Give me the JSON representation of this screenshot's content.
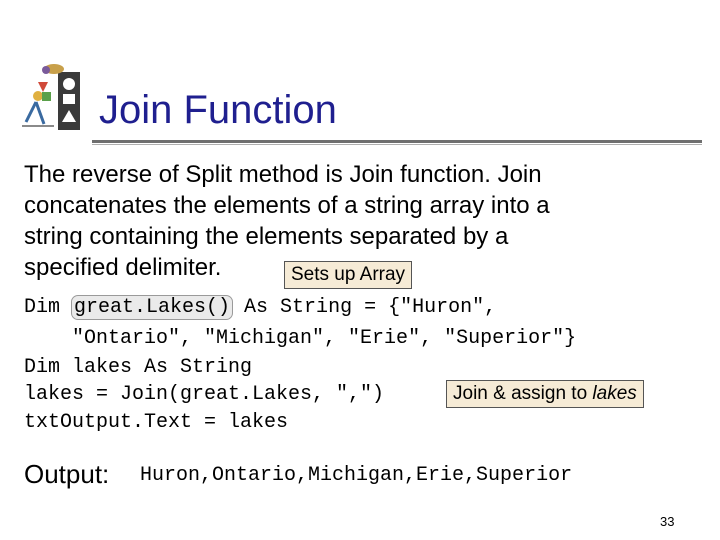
{
  "slide": {
    "title": "Join Function",
    "body_lines": [
      "The reverse of Split method is Join function. Join",
      "concatenates the elements of a string array into a",
      "string containing the elements separated by a",
      "specified delimiter."
    ],
    "callouts": {
      "sets_up_array": "Sets up Array",
      "join_assign_prefix": "Join & assign to ",
      "join_assign_emph": "lakes"
    },
    "code": {
      "line1_a": "Dim ",
      "line1_hl": "great.Lakes()",
      "line1_b": " As String = {\"Huron\",",
      "line2": "    \"Ontario\", \"Michigan\", \"Erie\", \"Superior\"}",
      "line3": "Dim lakes As String",
      "line4": "lakes = Join(great.Lakes, \",\")",
      "line5": "txtOutput.Text = lakes"
    },
    "output": {
      "label": "Output:",
      "value": "Huron,Ontario,Michigan,Erie,Superior"
    },
    "page_number": "33",
    "colors": {
      "title": "#1f1f8f",
      "callout_bg": "#f6ebd6",
      "rule": "#6f6f6f"
    },
    "icons": [
      "shapes-figure-icon"
    ]
  }
}
